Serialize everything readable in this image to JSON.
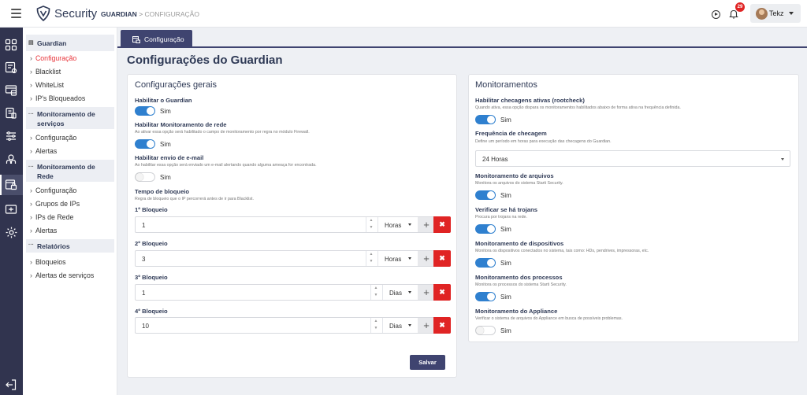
{
  "header": {
    "brand": "Security",
    "breadcrumb_section": "GUARDIAN",
    "breadcrumb_sep": ">",
    "breadcrumb_current": "CONFIGURAÇÃO",
    "notification_count": "29",
    "user_name": "Tekz"
  },
  "rail": {
    "icons": [
      "dashboard-icon",
      "assets-icon",
      "devices-icon",
      "reports-icon",
      "filters-icon",
      "network-icon",
      "guardian-icon",
      "cards-icon",
      "settings-icon"
    ],
    "active": "guardian-icon",
    "bottom_icon": "logout-icon"
  },
  "sidebar": {
    "guardian": {
      "title": "Guardian",
      "items": [
        "Configuração",
        "Blacklist",
        "WhiteList",
        "IP's Bloqueados"
      ],
      "active": "Configuração"
    },
    "servicos": {
      "title": "Monitoramento de serviços",
      "items": [
        "Configuração",
        "Alertas"
      ]
    },
    "rede": {
      "title": "Monitoramento de Rede",
      "items": [
        "Configuração",
        "Grupos de IPs",
        "IPs de Rede",
        "Alertas"
      ]
    },
    "relatorios": {
      "title": "Relatórios",
      "items": [
        "Bloqueios",
        "Alertas de serviços"
      ]
    }
  },
  "tab_label": "Configuração",
  "page_title": "Configurações do Guardian",
  "general": {
    "title": "Configurações gerais",
    "enable": {
      "label": "Habilitar o Guardian",
      "on": true,
      "state": "Sim"
    },
    "netmon": {
      "label": "Habilitar Monitoramento de rede",
      "desc": "Ao ativar essa opção será habilitado o campo de monitoramento por regra no módulo Firewall.",
      "on": true,
      "state": "Sim"
    },
    "email": {
      "label": "Habilitar envio de e-mail",
      "desc": "Ao habilitar essa opção será enviado um e-mail alertando quando alguma ameaça for encontrada.",
      "on": false,
      "state": "Sim"
    },
    "block_time": {
      "label": "Tempo de bloqueio",
      "desc": "Regra de bloqueio que o IP percorrerá antes de ir para Blacklist."
    },
    "blocks": [
      {
        "label": "1º Bloqueio",
        "value": "1",
        "unit": "Horas"
      },
      {
        "label": "2º Bloqueio",
        "value": "3",
        "unit": "Horas"
      },
      {
        "label": "3º Bloqueio",
        "value": "1",
        "unit": "Dias"
      },
      {
        "label": "4º Bloqueio",
        "value": "10",
        "unit": "Dias"
      }
    ],
    "save_label": "Salvar"
  },
  "monitoring": {
    "title": "Monitoramentos",
    "rootcheck": {
      "label": "Habilitar checagens ativas (rootcheck)",
      "desc": "Quando ativa, essa opção dispara os monitoramentos habilitados abaixo de forma ativa na frequência definida.",
      "on": true,
      "state": "Sim"
    },
    "frequency": {
      "label": "Frequência de checagem",
      "desc": "Define um período em horas para execução das checagens do Guardian.",
      "value": "24 Horas"
    },
    "files": {
      "label": "Monitoramento de arquivos",
      "desc": "Monitora os arquivos do sistema Starti Security.",
      "on": true,
      "state": "Sim"
    },
    "trojans": {
      "label": "Verificar se há trojans",
      "desc": "Procura por trojans na rede.",
      "on": true,
      "state": "Sim"
    },
    "devices": {
      "label": "Monitoramento de dispositivos",
      "desc": "Monitora os dispositivos conectados no sistema, tais como: HDs, pendrives, impressoras, etc.",
      "on": true,
      "state": "Sim"
    },
    "processes": {
      "label": "Monitoramento dos processos",
      "desc": "Monitora os processos do sistema Starti Security.",
      "on": true,
      "state": "Sim"
    },
    "appliance": {
      "label": "Monitoramento do Appliance",
      "desc": "Verificar o sistema de arquivos do Appliance em busca de possíveis problemas.",
      "on": false,
      "state": "Sim"
    }
  }
}
